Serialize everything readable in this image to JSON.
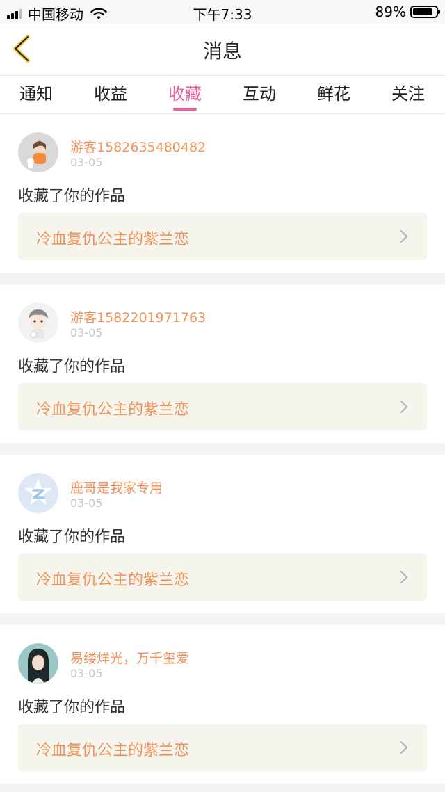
{
  "status_bar": {
    "carrier": "中国移动",
    "time": "下午7:33",
    "battery": "89%",
    "battery_level": 0.89
  },
  "nav": {
    "title": "消息",
    "back_icon": "chevron-left-icon"
  },
  "tabs": [
    {
      "label": "通知",
      "active": false
    },
    {
      "label": "收益",
      "active": false
    },
    {
      "label": "收藏",
      "active": true
    },
    {
      "label": "互动",
      "active": false
    },
    {
      "label": "鲜花",
      "active": false
    },
    {
      "label": "关注",
      "active": false
    }
  ],
  "colors": {
    "accent": "#e9609b",
    "username": "#f0935a",
    "link_bg": "#f5f5ee"
  },
  "messages": [
    {
      "user": "游客1582635480482",
      "date": "03-05",
      "action": "收藏了你的作品",
      "work": "冷血复仇公主的紫兰恋",
      "avatar": "avatar-girl-illustration"
    },
    {
      "user": "游客1582201971763",
      "date": "03-05",
      "action": "收藏了你的作品",
      "work": "冷血复仇公主的紫兰恋",
      "avatar": "avatar-boy-illustration"
    },
    {
      "user": "鹿哥是我家专用",
      "date": "03-05",
      "action": "收藏了你的作品",
      "work": "冷血复仇公主的紫兰恋",
      "avatar": "avatar-default-z-logo"
    },
    {
      "user": "易缕烊光，万千玺爱",
      "date": "03-05",
      "action": "收藏了你的作品",
      "work": "冷血复仇公主的紫兰恋",
      "avatar": "avatar-photo"
    }
  ]
}
